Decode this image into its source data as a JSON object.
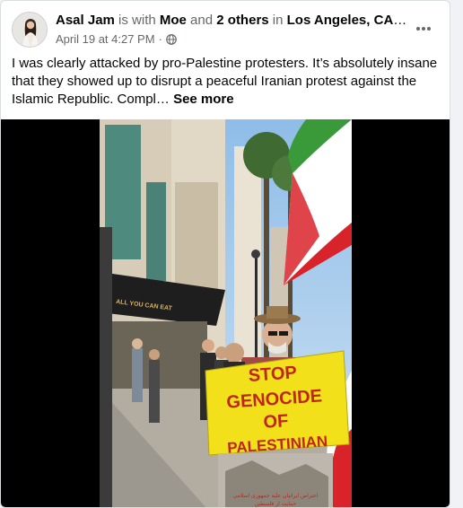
{
  "post": {
    "author": "Asal Jam",
    "connector1": " is with ",
    "tagged_name": "Moe",
    "connector2": " and ",
    "others": "2 others",
    "connector3": " in ",
    "location": "Los Angeles, CA, U...",
    "timestamp": "April 19 at 4:27 PM",
    "audience_icon": "globe-icon",
    "more_icon": "more-options-icon",
    "caption": "I was clearly attacked by pro-Palestine protesters. It’s absolutely insane that they showed up to disrupt a peaceful Iranian protest against the Islamic Republic. Compl…",
    "see_more": "See more"
  },
  "video": {
    "sign_lines": [
      "STOP",
      "GENOCIDE",
      "OF",
      "PALESTINIAN"
    ],
    "storefront_text": "ALL YOU CAN EAT",
    "footer_text_line1": "اعتراض ایرانیان علیه جمهوری اسلامی",
    "footer_text_line2": "حمایت از فلسطین"
  },
  "colors": {
    "text_primary": "#050505",
    "text_secondary": "#65676b",
    "sign_yellow": "#f2e11a",
    "sign_red": "#c0251a",
    "flag_green": "#3a9a3a",
    "flag_red": "#d8232a"
  }
}
